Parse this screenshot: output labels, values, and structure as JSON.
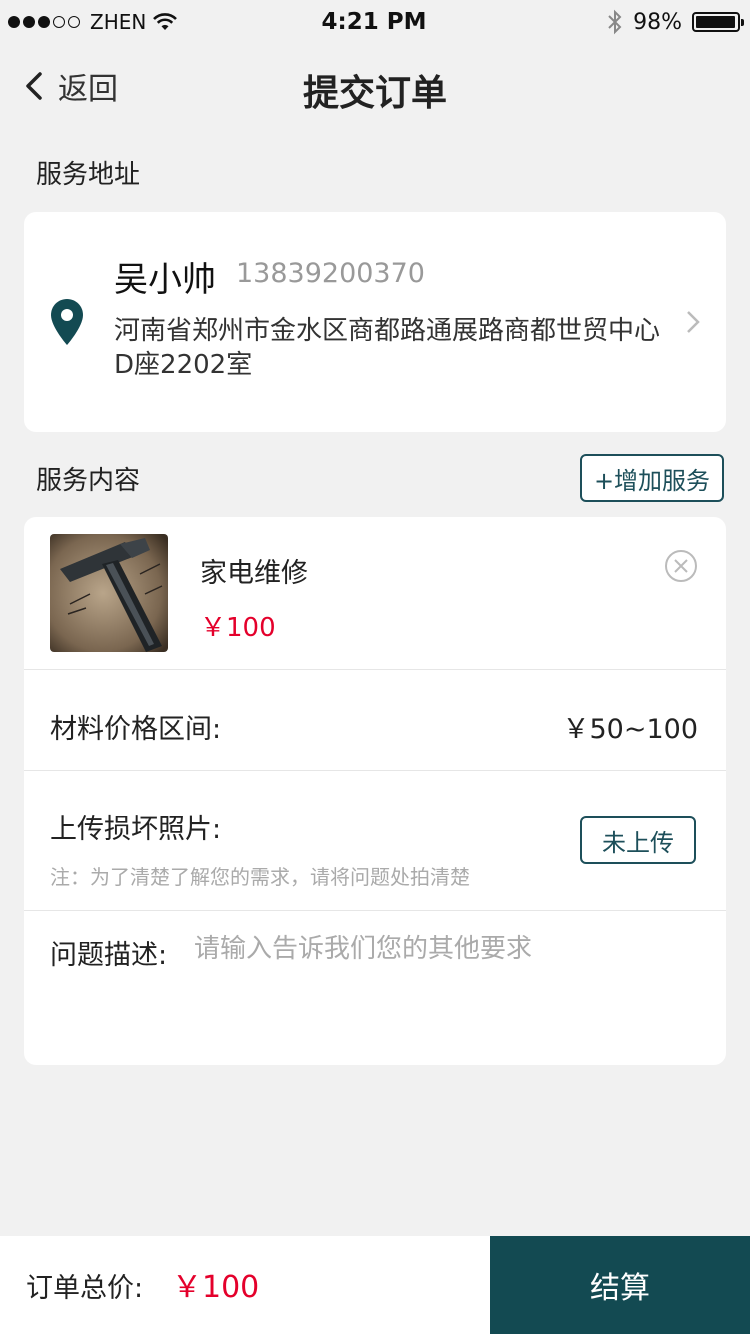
{
  "status_bar": {
    "carrier": "ZHEN",
    "time": "4:21 PM",
    "battery_text": "98%",
    "battery_level": 0.98,
    "icons": [
      "signal-dots",
      "wifi-icon",
      "bluetooth-icon",
      "battery-icon"
    ]
  },
  "nav": {
    "back_label": "返回",
    "title": "提交订单"
  },
  "address": {
    "section_label": "服务地址",
    "name": "吴小帅",
    "phone": "13839200370",
    "detail": "河南省郑州市金水区商都路通展路商都世贸中心D座2202室"
  },
  "service": {
    "section_label": "服务内容",
    "add_button": "+增加服务",
    "item": {
      "name": "家电维修",
      "price": "￥100",
      "image": "hammer-photo"
    },
    "material_label": "材料价格区间:",
    "material_value": "￥50~100",
    "upload_label": "上传损坏照片:",
    "upload_note": "注：为了清楚了解您的需求，请将问题处拍清楚",
    "upload_button": "未上传",
    "desc_label": "问题描述:",
    "desc_placeholder": "请输入告诉我们您的其他要求",
    "desc_value": ""
  },
  "bottom": {
    "total_label": "订单总价:",
    "total_value": "￥100",
    "checkout_button": "结算"
  },
  "colors": {
    "accent": "#134a52",
    "price": "#e4002b",
    "background": "#f1f1f1"
  }
}
